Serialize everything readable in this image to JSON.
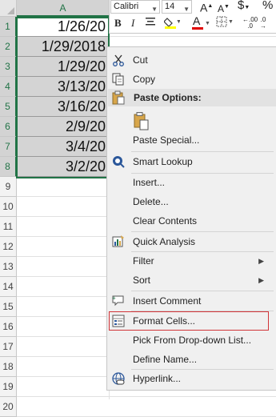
{
  "sheet": {
    "column_headers": [
      "A"
    ],
    "row_numbers": [
      "1",
      "2",
      "3",
      "4",
      "5",
      "6",
      "7",
      "8",
      "9",
      "10",
      "11",
      "12",
      "13",
      "14",
      "15",
      "16",
      "17",
      "18",
      "19",
      "20"
    ],
    "cells": [
      "1/26/20",
      "1/29/2018",
      "1/29/20",
      "3/13/20",
      "3/16/20",
      "2/9/20",
      "3/4/20",
      "3/2/20"
    ]
  },
  "mini_toolbar": {
    "font_name": "Calibri",
    "font_size": "14",
    "grow_font": "A",
    "shrink_font": "A",
    "currency": "$",
    "percent": "%",
    "bold": "B",
    "italic": "I",
    "font_color_letter": "A",
    "decimal_label": ".00"
  },
  "context_menu": {
    "items": {
      "cut": "Cut",
      "copy": "Copy",
      "paste_options": "Paste Options:",
      "paste_special": "Paste Special...",
      "smart_lookup": "Smart Lookup",
      "insert": "Insert...",
      "delete": "Delete...",
      "clear_contents": "Clear Contents",
      "quick_analysis": "Quick Analysis",
      "filter": "Filter",
      "sort": "Sort",
      "insert_comment": "Insert Comment",
      "format_cells": "Format Cells...",
      "pick_from_list": "Pick From Drop-down List...",
      "define_name": "Define Name...",
      "hyperlink": "Hyperlink..."
    },
    "highlighted_item": "format_cells"
  },
  "colors": {
    "excel_green": "#217346",
    "selection_fill": "#d4d4d4",
    "highlight_border": "#d13438",
    "menu_bg": "#f0f0f0"
  }
}
